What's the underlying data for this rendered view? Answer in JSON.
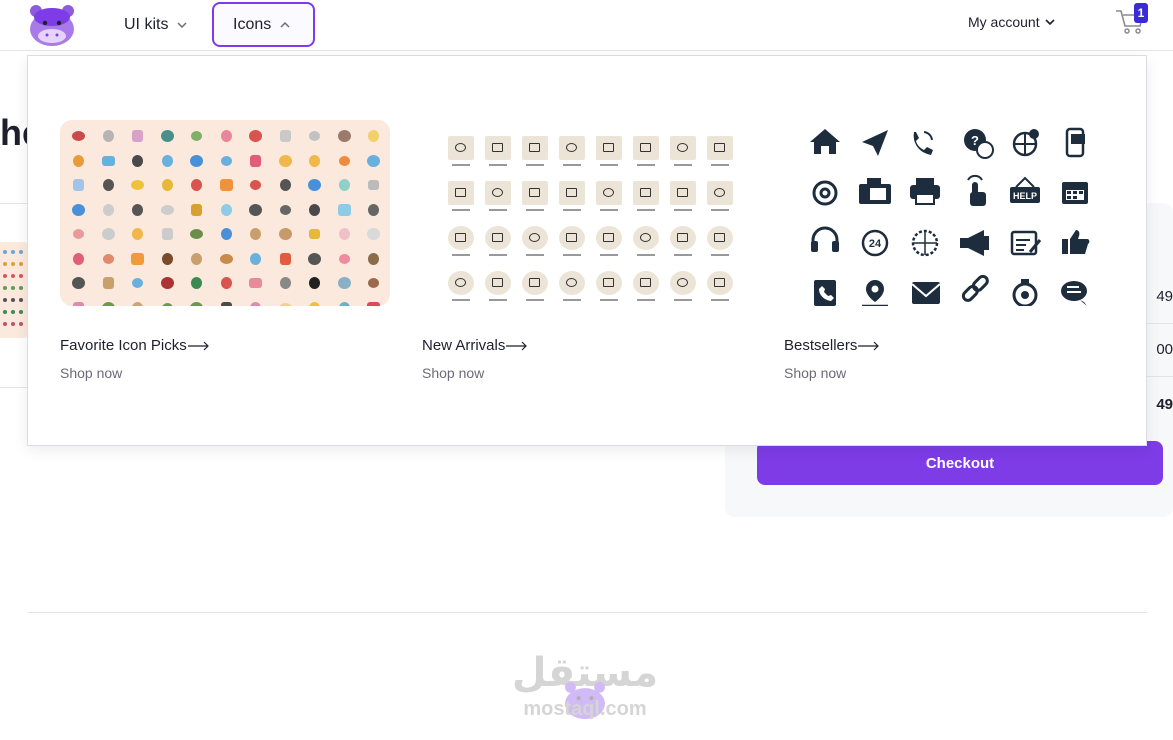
{
  "header": {
    "nav": [
      {
        "label": "UI kits"
      },
      {
        "label": "Icons"
      }
    ],
    "account_label": "My account",
    "cart_count": "1"
  },
  "dropdown": {
    "cards": [
      {
        "title": "Favorite Icon Picks",
        "link": "Shop now"
      },
      {
        "title": "New Arrivals",
        "link": "Shop now"
      },
      {
        "title": "Bestsellers",
        "link": "Shop now"
      }
    ],
    "bestseller_icons": [
      "home-icon",
      "send-icon",
      "phone-call-icon",
      "question-chat-icon",
      "globe-pin-icon",
      "mobile-doc-icon",
      "at-icon",
      "fax-icon",
      "printer-icon",
      "tap-icon",
      "help-sign-icon",
      "calendar-icon",
      "headset-icon",
      "24h-icon",
      "globe-icon",
      "megaphone-icon",
      "browser-edit-icon",
      "thumbs-up-icon",
      "contact-book-icon",
      "location-icon",
      "mail-icon",
      "link-icon",
      "stopwatch-icon",
      "chat-bubbles-icon"
    ],
    "help_text": "HELP",
    "clock_text": "24"
  },
  "background": {
    "heading_fragment": "he",
    "summary_values": [
      "49",
      "00",
      "49"
    ],
    "checkout_label": "Checkout"
  },
  "watermark": {
    "arabic": "مستقل",
    "latin": "mostaql.com"
  },
  "colors": {
    "accent": "#7d3ce6",
    "icon_dark": "#1e2d3d",
    "peach": "#fbe9de",
    "tile": "#ece4d6"
  }
}
